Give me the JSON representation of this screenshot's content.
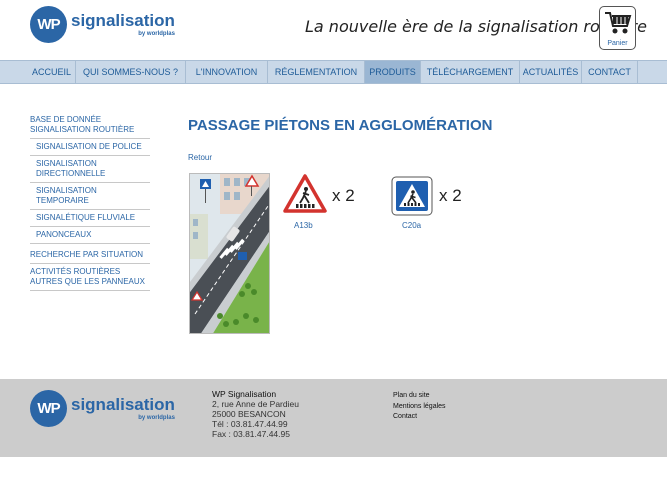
{
  "header": {
    "logo_badge": "WP",
    "logo_word": "signalisation",
    "logo_by": "by worldplas",
    "tagline": "La nouvelle ère de la signalisation routière",
    "cart_label": "Panier"
  },
  "nav": {
    "items": [
      {
        "label": "ACCUEIL"
      },
      {
        "label": "QUI SOMMES-NOUS ?"
      },
      {
        "label": "L'INNOVATION"
      },
      {
        "label": "RÉGLEMENTATION"
      },
      {
        "label": "PRODUITS"
      },
      {
        "label": "TÉLÉCHARGEMENT"
      },
      {
        "label": "ACTUALITÉS"
      },
      {
        "label": "CONTACT"
      }
    ],
    "active": "PRODUITS"
  },
  "sidebar": {
    "items": [
      {
        "label": "BASE DE DONNÉE SIGNALISATION ROUTIÈRE"
      },
      {
        "label": "SIGNALISATION DE POLICE"
      },
      {
        "label": "SIGNALISATION DIRECTIONNELLE"
      },
      {
        "label": "SIGNALISATION TEMPORAIRE"
      },
      {
        "label": "SIGNALÉTIQUE FLUVIALE"
      },
      {
        "label": "PANONCEAUX"
      },
      {
        "label": "RECHERCHE PAR SITUATION"
      },
      {
        "label": "ACTIVITÉS ROUTIÈRES AUTRES QUE LES PANNEAUX"
      }
    ]
  },
  "main": {
    "title": "PASSAGE PIÉTONS EN AGGLOMÉRATION",
    "back_link": "Retour",
    "signs": [
      {
        "code": "A13b",
        "quantity": "x 2",
        "icon": "pedestrian-crossing-warning-icon"
      },
      {
        "code": "C20a",
        "quantity": "x 2",
        "icon": "pedestrian-crossing-info-icon"
      }
    ]
  },
  "footer": {
    "company": "WP Signalisation",
    "address_line1": "2, rue Anne de Pardieu",
    "address_line2": "25000 BESANCON",
    "tel": "Tél : 03.81.47.44.99",
    "fax": "Fax : 03.81.47.44.95",
    "links": [
      {
        "label": "Plan du site"
      },
      {
        "label": "Mentions légales"
      },
      {
        "label": "Contact"
      }
    ]
  },
  "colors": {
    "brand_blue": "#2b66a6",
    "nav_bg": "#c9d8e8",
    "nav_active": "#9ab6d3",
    "footer_bg": "#cccccc",
    "warning_red": "#d3332e"
  }
}
